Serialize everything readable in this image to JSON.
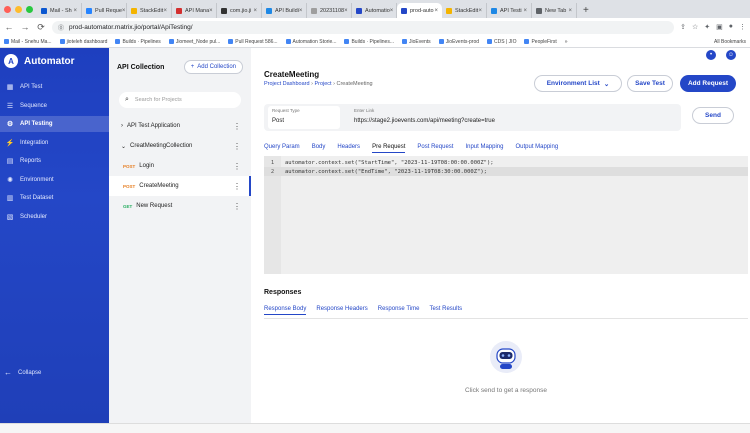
{
  "browser": {
    "tabs": [
      {
        "label": "Mail - Sh",
        "color": "#0b57d0"
      },
      {
        "label": "Pull Reque",
        "color": "#2684ff"
      },
      {
        "label": "StackEdit",
        "color": "#f4b400"
      },
      {
        "label": "API Mana",
        "color": "#d32f2f"
      },
      {
        "label": "com.jio.ji",
        "color": "#333333"
      },
      {
        "label": "API Buildi",
        "color": "#1e88e5"
      },
      {
        "label": "20231108",
        "color": "#9e9e9e"
      },
      {
        "label": "Automatio",
        "color": "#2447c7"
      },
      {
        "label": "prod-auto",
        "color": "#2447c7",
        "active": true
      },
      {
        "label": "StackEdit",
        "color": "#f4b400"
      },
      {
        "label": "API Testi",
        "color": "#1e88e5"
      },
      {
        "label": "New Tab",
        "color": "#5f6368"
      }
    ],
    "url": "prod-automator.matrix.jio/portal/ApiTesting/",
    "bookmarks": [
      "Mail - Snehu Ma...",
      "jioteleh dashboard",
      "Builds · Pipelines",
      "Jiomeet_Node pul...",
      "Pull Request 586...",
      "Automation Storie...",
      "Builds · Pipelines...",
      "JioEvents",
      "JioEvents-prod",
      "CDS | JIO",
      "PeopleFirst"
    ],
    "all_bookmarks": "All Bookmarks"
  },
  "sidebar": {
    "brand": "Automator",
    "items": [
      {
        "label": "API Test",
        "icon": "dashboard-icon"
      },
      {
        "label": "Sequence",
        "icon": "list-icon"
      },
      {
        "label": "API Testing",
        "icon": "api-icon",
        "active": true
      },
      {
        "label": "Integration",
        "icon": "plug-icon"
      },
      {
        "label": "Reports",
        "icon": "report-icon"
      },
      {
        "label": "Environment",
        "icon": "gear-icon"
      },
      {
        "label": "Test Dataset",
        "icon": "table-icon"
      },
      {
        "label": "Scheduler",
        "icon": "calendar-icon"
      }
    ],
    "collapse": "Collapse"
  },
  "collections": {
    "title": "API Collection",
    "add_label": "Add Collection",
    "search_placeholder": "Search for Projects",
    "tree": [
      {
        "label": "API Test Application",
        "caret": ">"
      },
      {
        "label": "CreatMeetingCollection",
        "caret": "v"
      }
    ],
    "requests": [
      {
        "method": "POST",
        "label": "Login"
      },
      {
        "method": "POST",
        "label": "CreateMeeting",
        "selected": true
      },
      {
        "method": "GET",
        "label": "New Request"
      }
    ]
  },
  "main": {
    "title": "CreateMeeting",
    "breadcrumb": [
      "Project Dashboard",
      "Project",
      "CreateMeeting"
    ],
    "env_list": "Environment List",
    "save_test": "Save Test",
    "add_request": "Add Request",
    "request_type_label": "Request Type",
    "request_type": "Post",
    "link_label": "Enter Link",
    "link": "https://stage2.jioevents.com/api/meeting?create=true",
    "send": "Send",
    "subtabs": [
      "Query Param",
      "Body",
      "Headers",
      "Pre Request",
      "Post Request",
      "Input Mapping",
      "Output Mapping"
    ],
    "active_subtab": "Pre Request",
    "code_lines": [
      "automator.context.set(\"StartTime\", \"2023-11-19T08:00:00.000Z\");",
      "automator.context.set(\"EndTime\", \"2023-11-19T08:30:00.000Z\");"
    ],
    "responses_title": "Responses",
    "response_tabs": [
      "Response Body",
      "Response Headers",
      "Response Time",
      "Test Results"
    ],
    "empty_message": "Click send to get a response"
  }
}
